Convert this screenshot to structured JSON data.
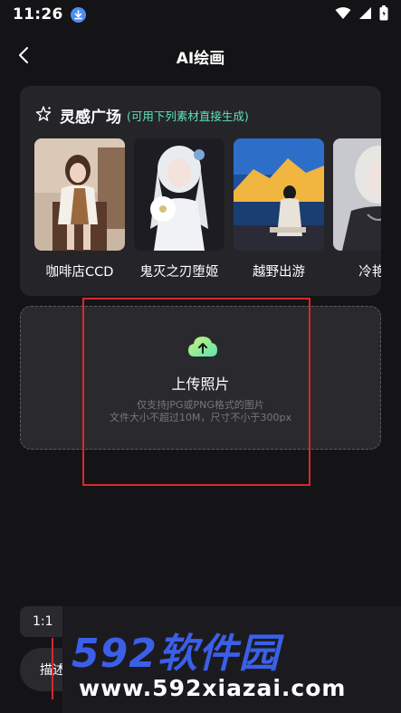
{
  "status_bar": {
    "time": "11:26"
  },
  "header": {
    "title": "AI绘画"
  },
  "inspiration": {
    "title": "灵感广场",
    "hint": "(可用下列素材直接生成)",
    "items": [
      {
        "label": "咖啡店CCD"
      },
      {
        "label": "鬼灭之刃堕姬"
      },
      {
        "label": "越野出游"
      },
      {
        "label": "冷艳少"
      }
    ]
  },
  "upload": {
    "title": "上传照片",
    "hint_line1": "仅支持JPG或PNG格式的图片",
    "hint_line2": "文件大小不超过10M，尺寸不小于300px"
  },
  "controls": {
    "ratio": "1:1",
    "describe": "描述"
  },
  "watermark": {
    "brand": "592软件园",
    "url": "www.592xiazai.com"
  },
  "colors": {
    "background": "#141416",
    "card": "#252529",
    "accent_green": "#5fe3b3",
    "annotation_red": "#d8282e",
    "watermark_blue": "#3b5fe8"
  }
}
